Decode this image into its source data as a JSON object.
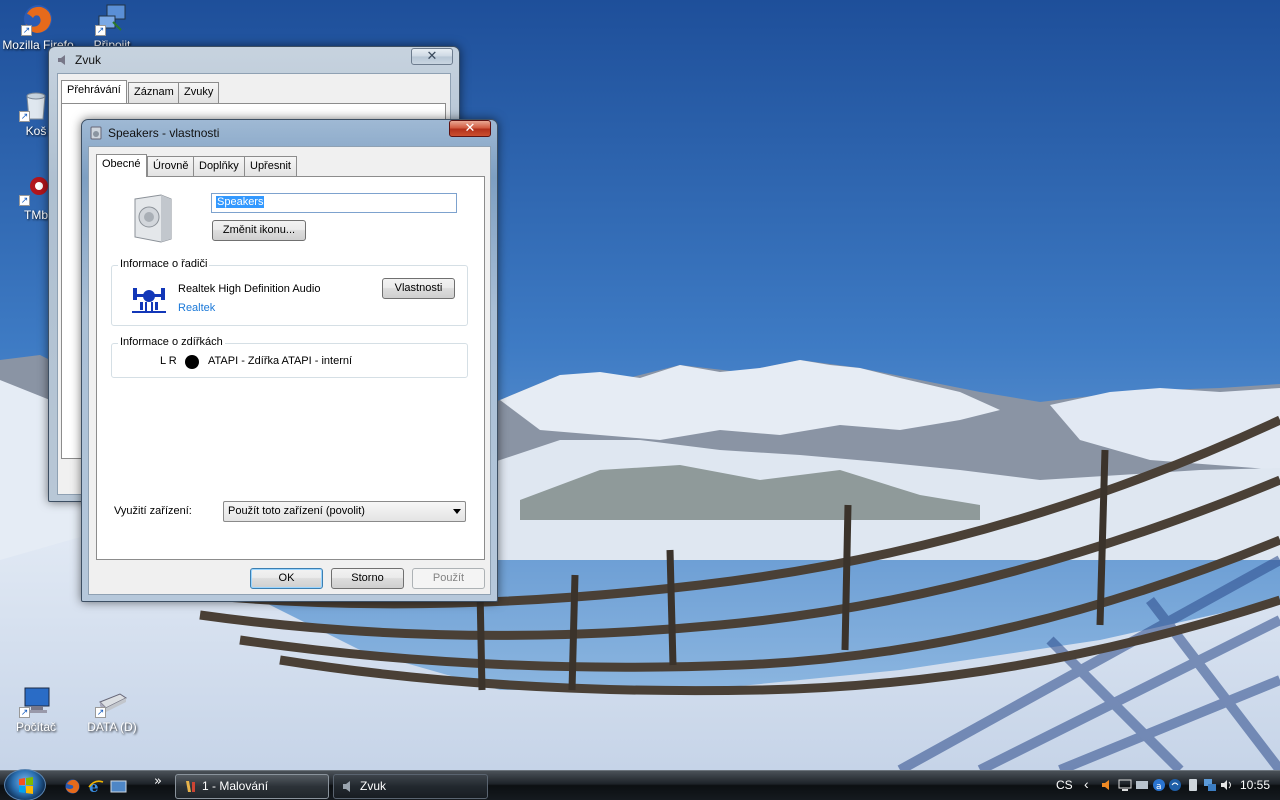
{
  "desktop": {
    "icons": [
      {
        "label": "Mozilla Firefo"
      },
      {
        "label": "Připojit"
      },
      {
        "label": "Koš"
      },
      {
        "label": "TMb"
      },
      {
        "label": "Počítač"
      },
      {
        "label": "DATA (D)"
      }
    ]
  },
  "zvuk_window": {
    "title": "Zvuk",
    "close_glyph": "✕",
    "tabs": [
      "Přehrávání",
      "Záznam",
      "Zvuky"
    ]
  },
  "speakers_dialog": {
    "title": "Speakers - vlastnosti",
    "close_glyph": "✕",
    "tabs": [
      "Obecné",
      "Úrovně",
      "Doplňky",
      "Upřesnit"
    ],
    "device_name_value": "Speakers",
    "change_icon_label": "Změnit ikonu...",
    "controller_group": {
      "legend": "Informace o řadiči",
      "driver_name": "Realtek High Definition Audio",
      "vendor_link": "Realtek",
      "properties_button": "Vlastnosti"
    },
    "jack_group": {
      "legend": "Informace o zdířkách",
      "channels": "L R",
      "jack_description": "ATAPI - Zdířka ATAPI - interní"
    },
    "usage": {
      "label": "Využití zařízení:",
      "selected_option": "Použít toto zařízení (povolit)"
    },
    "buttons": {
      "ok": "OK",
      "cancel": "Storno",
      "apply": "Použít"
    }
  },
  "taskbar": {
    "overflow_chevron": "»",
    "tasks": [
      {
        "label": "1 - Malování",
        "active": true
      },
      {
        "label": "Zvuk",
        "active": false
      }
    ],
    "language": "CS",
    "tray_chevron": "‹",
    "clock": "10:55"
  }
}
